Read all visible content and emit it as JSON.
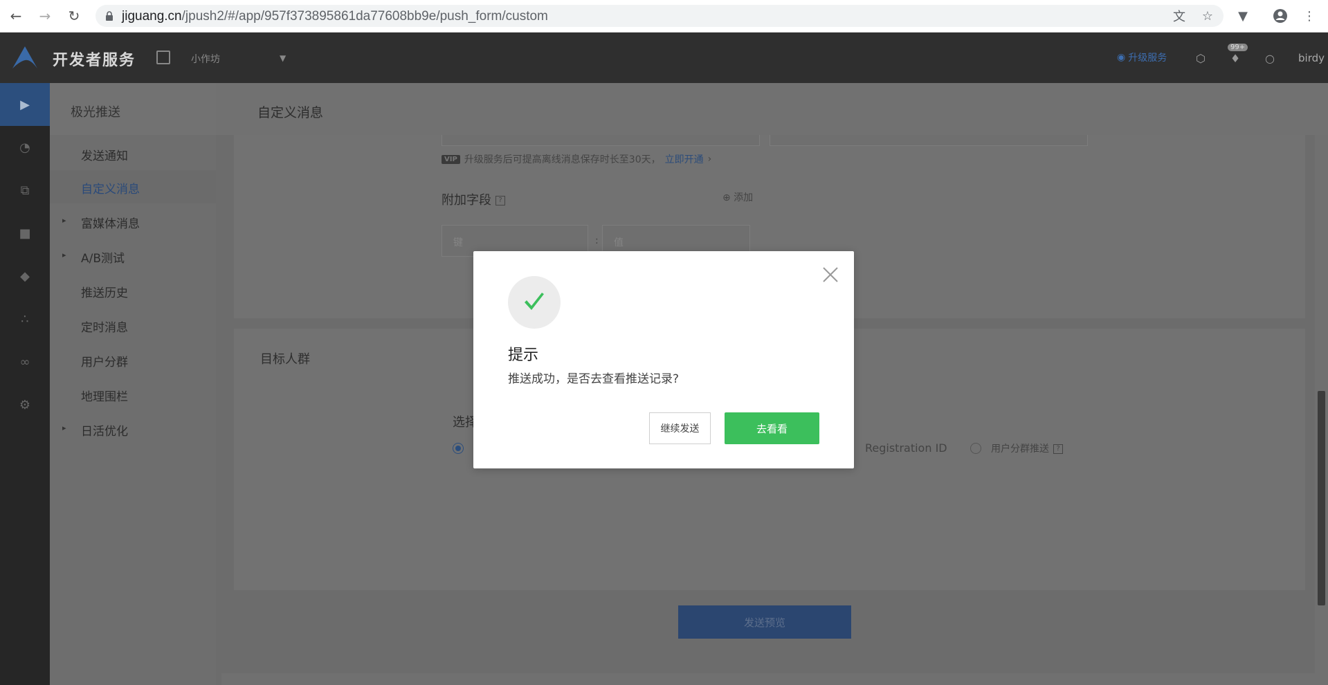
{
  "browser": {
    "url_host": "jiguang.cn",
    "url_path": "/jpush2/#/app/957f373895861da77608bb9e/push_form/custom"
  },
  "header": {
    "brand": "开发者服务",
    "app_name": "小作坊",
    "upgrade": "升级服务",
    "badge": "99+",
    "username": "birdy"
  },
  "subnav": {
    "title": "极光推送",
    "items": [
      {
        "label": "发送通知",
        "expandable": false
      },
      {
        "label": "自定义消息",
        "expandable": false,
        "selected": true
      },
      {
        "label": "富媒体消息",
        "expandable": true
      },
      {
        "label": "A/B测试",
        "expandable": true
      },
      {
        "label": "推送历史",
        "expandable": false
      },
      {
        "label": "定时消息",
        "expandable": false
      },
      {
        "label": "用户分群",
        "expandable": false
      },
      {
        "label": "地理围栏",
        "expandable": false
      },
      {
        "label": "日活优化",
        "expandable": true
      }
    ]
  },
  "main": {
    "page_title": "自定义消息",
    "vip_tag": "VIP",
    "vip_text": "升级服务后可提高离线消息保存时长至30天，",
    "vip_link": "立即开通",
    "extra_fields_label": "附加字段",
    "help_glyph": "?",
    "add_label": "添加",
    "key_placeholder": "键",
    "value_placeholder": "值",
    "colon": ":",
    "target_title": "目标人群",
    "choose_label": "选择",
    "option_registration": "Registration ID",
    "option_segment": "用户分群推送",
    "preview_button": "发送预览"
  },
  "modal": {
    "title": "提示",
    "message": "推送成功，是否去查看推送记录?",
    "continue_button": "继续发送",
    "go_button": "去看看"
  },
  "colors": {
    "success_green": "#3cbf5c",
    "accent_blue": "#2c4f7e"
  }
}
